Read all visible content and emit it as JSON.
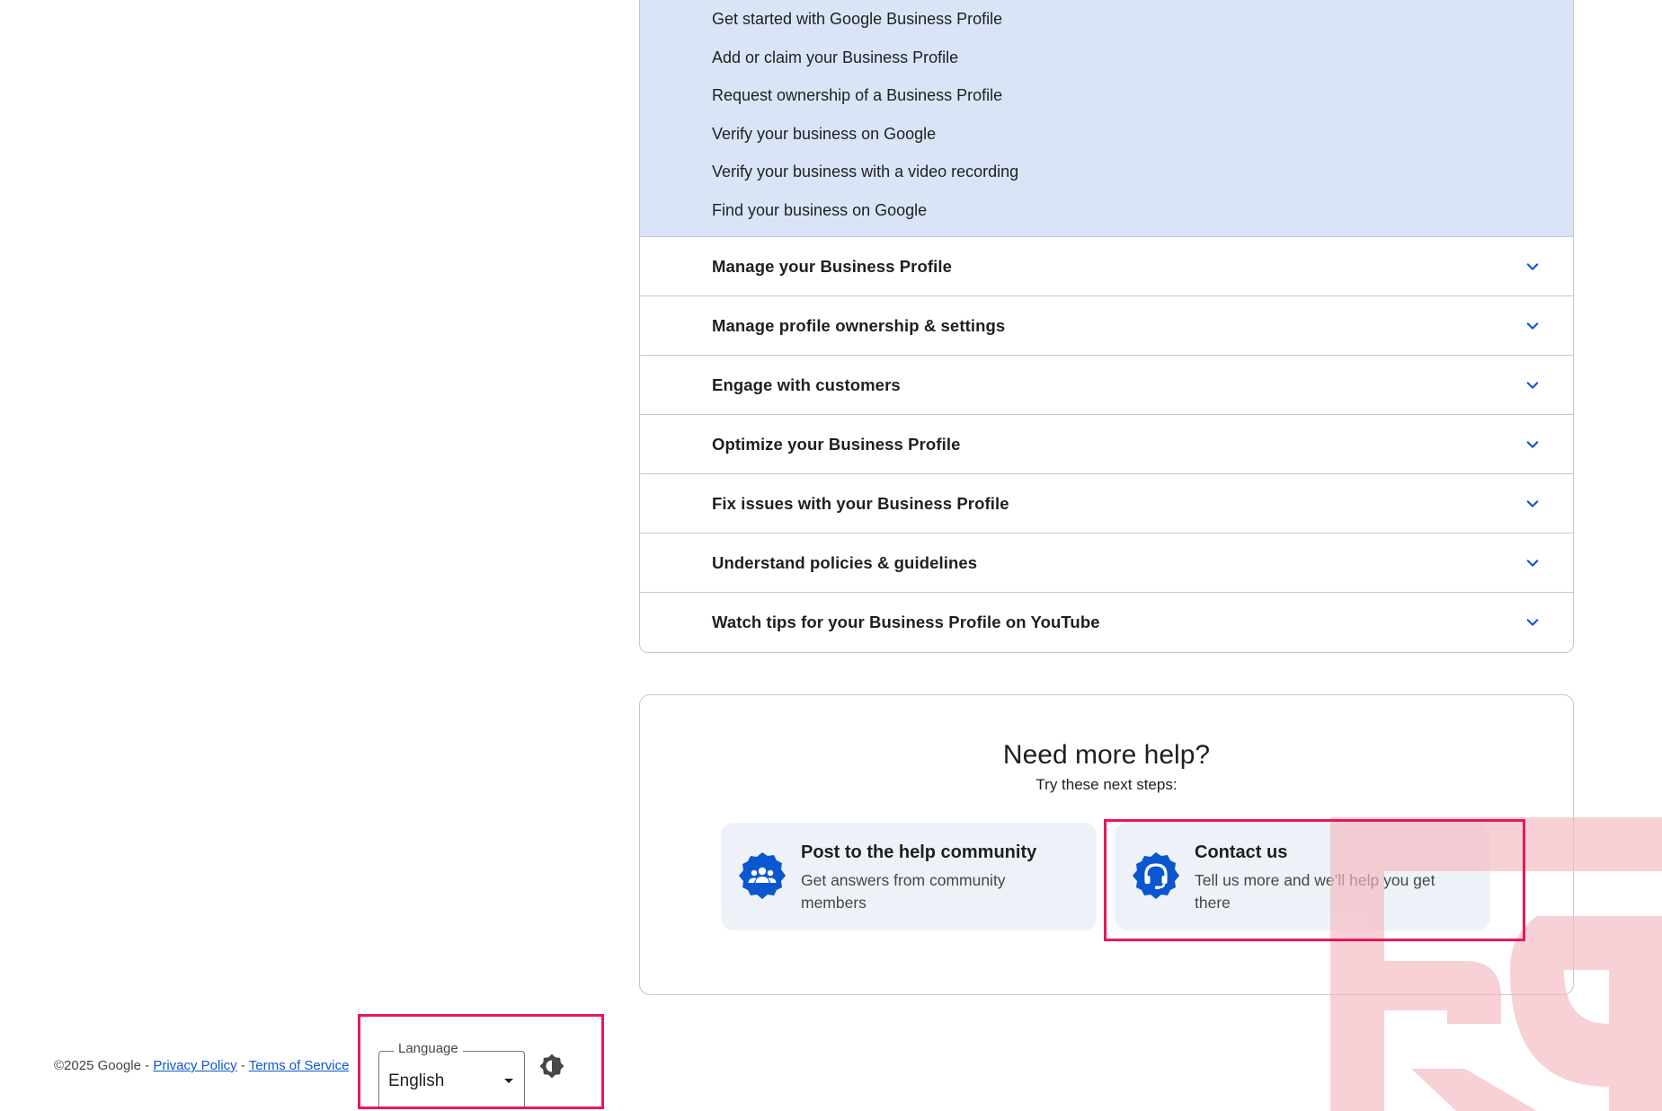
{
  "accordion": {
    "expanded_links": [
      "Get started with Google Business Profile",
      "Add or claim your Business Profile",
      "Request ownership of a Business Profile",
      "Verify your business on Google",
      "Verify your business with a video recording",
      "Find your business on Google"
    ],
    "sections": [
      "Manage your Business Profile",
      "Manage profile ownership & settings",
      "Engage with customers",
      "Optimize your Business Profile",
      "Fix issues with your Business Profile",
      "Understand policies & guidelines",
      "Watch tips for your Business Profile on YouTube"
    ],
    "chevron_icon": "chevron-down-icon"
  },
  "help": {
    "title": "Need more help?",
    "subtitle": "Try these next steps:",
    "options": [
      {
        "title": "Post to the help community",
        "description": "Get answers from community members",
        "icon": "people-group-icon"
      },
      {
        "title": "Contact us",
        "description": "Tell us more and we’ll help you get there",
        "icon": "headset-icon"
      }
    ]
  },
  "footer": {
    "copyright": "©2025 Google",
    "separator": " - ",
    "privacy_label": "Privacy Policy",
    "terms_label": "Terms of Service",
    "language_label": "Language",
    "language_value": "English",
    "theme_icon": "brightness-icon"
  },
  "colors": {
    "accent_blue": "#0b57d0",
    "expanded_bg": "#d9e5f7",
    "option_bg": "#eef2f8",
    "highlight": "#e8175d",
    "watermark": "#f4b9c0"
  }
}
